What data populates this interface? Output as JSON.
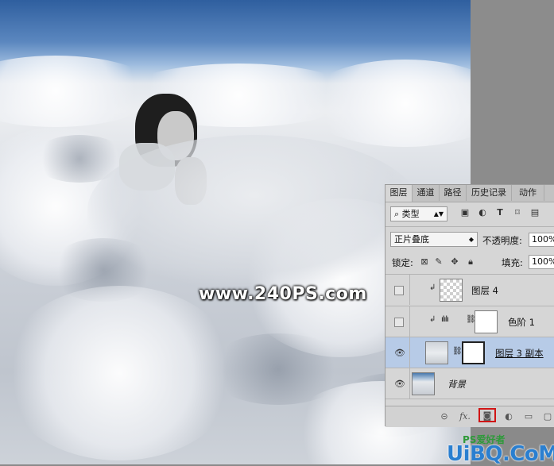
{
  "watermark": "www.240PS.com",
  "brand": {
    "top": "PS爱好者",
    "main": "UiBQ.CoM"
  },
  "panel": {
    "tabs": [
      "图层",
      "通道",
      "路径",
      "历史记录",
      "动作"
    ],
    "filter": {
      "kind_label": "类型",
      "search_icon": "search-icon"
    },
    "blend": {
      "mode": "正片叠底",
      "opacity_label": "不透明度:",
      "opacity_value": "100%"
    },
    "lock": {
      "label": "锁定:",
      "fill_label": "填充:",
      "fill_value": "100%"
    },
    "layers": [
      {
        "name": "图层 4",
        "visible": false,
        "clipped": true
      },
      {
        "name": "色阶 1",
        "visible": false,
        "clipped": true
      },
      {
        "name": "图层 3 副本",
        "visible": true,
        "selected": true
      },
      {
        "name": "背景",
        "visible": true
      }
    ],
    "bottom_icons": [
      "link-icon",
      "fx-icon",
      "add-mask-icon",
      "adjustment-icon",
      "folder-icon",
      "new-layer-icon"
    ],
    "fx_label": "fx."
  }
}
